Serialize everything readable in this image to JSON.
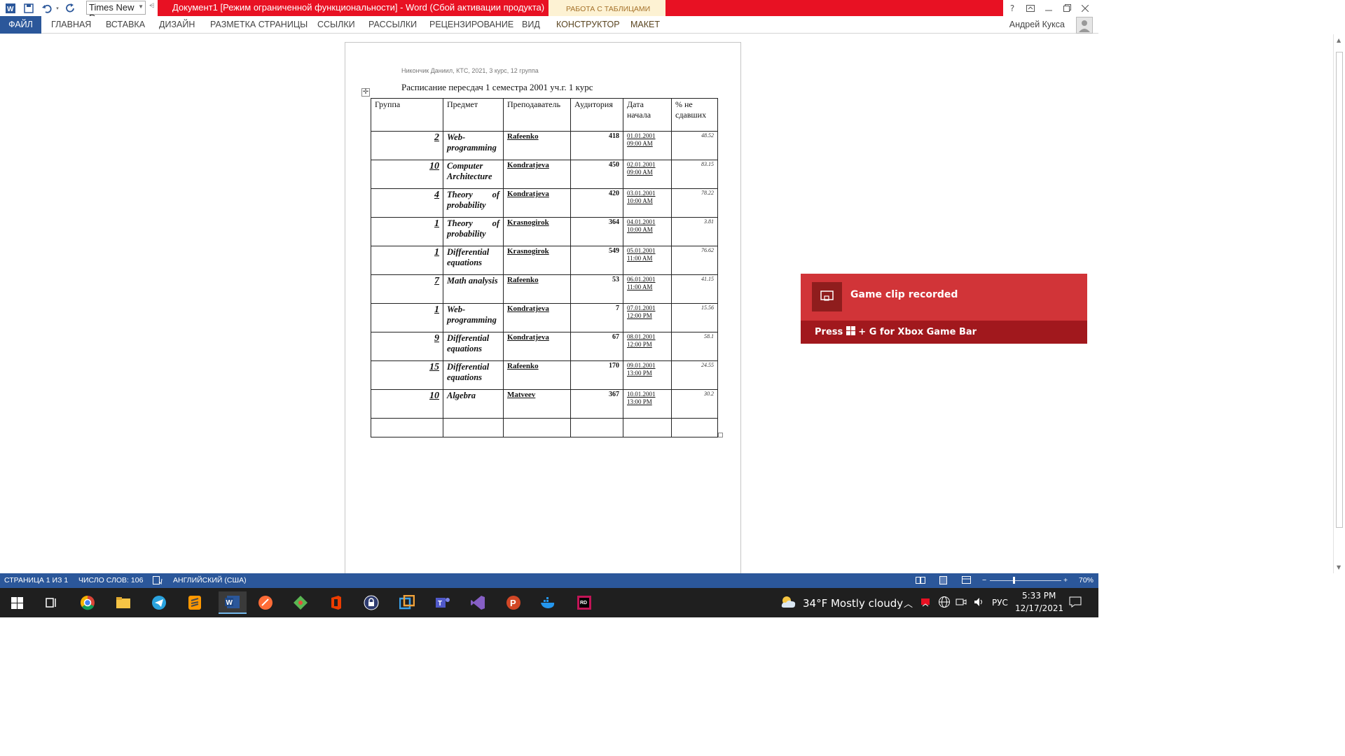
{
  "titlebar": {
    "font_name": "Times New R",
    "document_title": "Документ1 [Режим ограниченной функциональности] -  Word (Сбой активации продукта)",
    "context_tab_group": "РАБОТА С ТАБЛИЦАМИ",
    "help": "?",
    "brand_color": "#e81123"
  },
  "ribbon": {
    "file": "ФАЙЛ",
    "tabs": [
      "ГЛАВНАЯ",
      "ВСТАВКА",
      "ДИЗАЙН",
      "РАЗМЕТКА СТРАНИЦЫ",
      "ССЫЛКИ",
      "РАССЫЛКИ",
      "РЕЦЕНЗИРОВАНИЕ",
      "ВИД",
      "КОНСТРУКТОР",
      "МАКЕТ"
    ],
    "user": "Андрей Кукса",
    "accent_color": "#2b579a"
  },
  "document": {
    "header_line": "Никончик Даниил, КТС, 2021, 3 курс, 12 группа",
    "title": "Расписание пересдач 1 семестра 2001 уч.г. 1 курс",
    "table": {
      "headers": [
        "Группа",
        "Предмет",
        "Преподаватель",
        "Аудитория",
        "Дата начала",
        "% не сдавших"
      ],
      "rows": [
        {
          "group": "2",
          "subject": "Web-programming",
          "teacher": "Rafeenko",
          "room": "418",
          "date": "01.01.2001",
          "time": "09:00 AM",
          "pct": "48.52"
        },
        {
          "group": "10",
          "subject": "Computer Architecture",
          "teacher": "Kondratjeva",
          "room": "450",
          "date": "02.01.2001",
          "time": "09:00 AM",
          "pct": "83.15"
        },
        {
          "group": "4",
          "subject": "Theory of probability",
          "teacher": "Kondratjeva",
          "room": "420",
          "date": "03.01.2001",
          "time": "10:00 AM",
          "pct": "78.22"
        },
        {
          "group": "1",
          "subject": "Theory of probability",
          "teacher": "Krasnogirok",
          "room": "364",
          "date": "04.01.2001",
          "time": "10:00 AM",
          "pct": "3.81"
        },
        {
          "group": "1",
          "subject": "Differential equations",
          "teacher": "Krasnogirok",
          "room": "549",
          "date": "05.01.2001",
          "time": "11:00 AM",
          "pct": "76.62"
        },
        {
          "group": "7",
          "subject": "Math analysis",
          "teacher": "Rafeenko",
          "room": "53",
          "date": "06.01.2001",
          "time": "11:00 AM",
          "pct": "41.15"
        },
        {
          "group": "1",
          "subject": "Web-programming",
          "teacher": "Kondratjeva",
          "room": "7",
          "date": "07.01.2001",
          "time": "12:00 PM",
          "pct": "15.56"
        },
        {
          "group": "9",
          "subject": "Differential equations",
          "teacher": "Kondratjeva",
          "room": "67",
          "date": "08.01.2001",
          "time": "12:00 PM",
          "pct": "58.1"
        },
        {
          "group": "15",
          "subject": "Differential equations",
          "teacher": "Rafeenko",
          "room": "170",
          "date": "09.01.2001",
          "time": "13:00 PM",
          "pct": "24.55"
        },
        {
          "group": "10",
          "subject": "Algebra",
          "teacher": "Matveev",
          "room": "367",
          "date": "10.01.2001",
          "time": "13:00 PM",
          "pct": "30.2"
        }
      ]
    }
  },
  "toast": {
    "title": "Game clip recorded",
    "press": "Press",
    "shortcut": "+ G for Xbox Game Bar"
  },
  "statusbar": {
    "page": "СТРАНИЦА 1 ИЗ 1",
    "words": "ЧИСЛО СЛОВ: 106",
    "language": "АНГЛИЙСКИЙ (США)",
    "zoom": "70%",
    "zoom_level": 70
  },
  "taskbar": {
    "weather": "34°F  Mostly cloudy",
    "lang": "РУС",
    "time": "5:33 PM",
    "date": "12/17/2021"
  }
}
